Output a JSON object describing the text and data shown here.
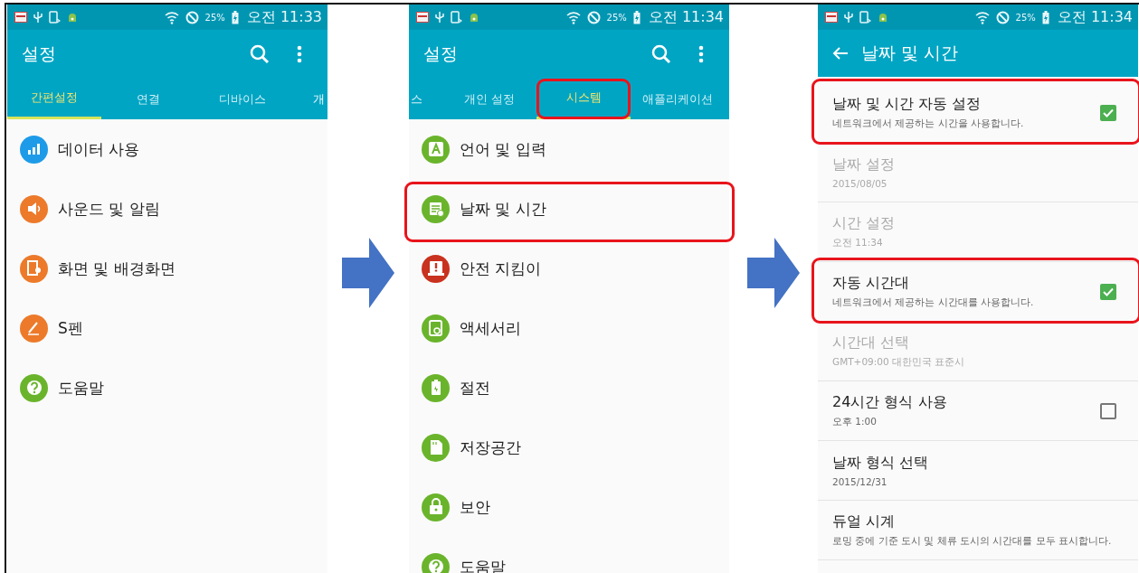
{
  "panels": [
    {
      "status_bar": {
        "battery": "25%",
        "time": "오전 11:33"
      },
      "app_bar": {
        "kind": "main",
        "title": "설정"
      },
      "tabs": [
        {
          "label": "간편설정",
          "kind": "full",
          "selected": true,
          "highlighted": false
        },
        {
          "label": "연결",
          "kind": "full",
          "selected": false,
          "highlighted": false
        },
        {
          "label": "디바이스",
          "kind": "full",
          "selected": false,
          "highlighted": false
        },
        {
          "label": "개",
          "kind": "cut-end",
          "selected": false,
          "highlighted": false
        }
      ],
      "items": [
        {
          "label": "데이터 사용",
          "kind": "chart",
          "color": "#1e9be8",
          "highlighted": false
        },
        {
          "label": "사운드 및 알림",
          "kind": "sound",
          "color": "#ec7a2a",
          "highlighted": false
        },
        {
          "label": "화면 및 배경화면",
          "kind": "screen",
          "color": "#ec7a2a",
          "highlighted": false
        },
        {
          "label": "S펜",
          "kind": "pen",
          "color": "#ec7a2a",
          "highlighted": false
        },
        {
          "label": "도움말",
          "kind": "help",
          "color": "#6ab42c",
          "highlighted": false
        }
      ]
    },
    {
      "status_bar": {
        "battery": "25%",
        "time": "오전 11:34"
      },
      "app_bar": {
        "kind": "main",
        "title": "설정"
      },
      "tabs": [
        {
          "label": "스",
          "kind": "cut-start",
          "selected": false,
          "highlighted": false
        },
        {
          "label": "개인 설정",
          "kind": "full",
          "selected": false,
          "highlighted": false
        },
        {
          "label": "시스템",
          "kind": "full",
          "selected": true,
          "highlighted": true
        },
        {
          "label": "애플리케이션",
          "kind": "full",
          "selected": false,
          "highlighted": false
        }
      ],
      "items": [
        {
          "label": "언어 및 입력",
          "kind": "letter",
          "color": "#6ab42c",
          "highlighted": false
        },
        {
          "label": "날짜 및 시간",
          "kind": "calendar",
          "color": "#6ab42c",
          "highlighted": true
        },
        {
          "label": "안전 지킴이",
          "kind": "alert",
          "color": "#c8321e",
          "highlighted": false
        },
        {
          "label": "액세서리",
          "kind": "accessory",
          "color": "#6ab42c",
          "highlighted": false
        },
        {
          "label": "절전",
          "kind": "battery",
          "color": "#6ab42c",
          "highlighted": false
        },
        {
          "label": "저장공간",
          "kind": "storage",
          "color": "#6ab42c",
          "highlighted": false
        },
        {
          "label": "보안",
          "kind": "lock",
          "color": "#6ab42c",
          "highlighted": false
        },
        {
          "label": "도움말",
          "kind": "help",
          "color": "#6ab42c",
          "highlighted": false
        }
      ]
    },
    {
      "status_bar": {
        "battery": "25%",
        "time": "오전 11:34"
      },
      "app_bar": {
        "kind": "sub",
        "title": "날짜 및 시간"
      },
      "settings": [
        {
          "title": "날짜 및 시간 자동 설정",
          "subtitle": "네트워크에서 제공하는 시간을 사용합니다.",
          "disabled": false,
          "kind": "checkbox",
          "checked": true,
          "highlighted": true
        },
        {
          "title": "날짜 설정",
          "subtitle": "2015/08/05",
          "disabled": true,
          "kind": "plain",
          "highlighted": false
        },
        {
          "title": "시간 설정",
          "subtitle": "오전 11:34",
          "disabled": true,
          "kind": "plain",
          "highlighted": false
        },
        {
          "title": "자동 시간대",
          "subtitle": "네트워크에서 제공하는 시간대를 사용합니다.",
          "disabled": false,
          "kind": "checkbox",
          "checked": true,
          "highlighted": true
        },
        {
          "title": "시간대 선택",
          "subtitle": "GMT+09:00 대한민국 표준시",
          "disabled": true,
          "kind": "plain",
          "highlighted": false
        },
        {
          "title": "24시간 형식 사용",
          "subtitle": "오후 1:00",
          "disabled": false,
          "kind": "checkbox",
          "checked": false,
          "highlighted": false
        },
        {
          "title": "날짜 형식 선택",
          "subtitle": "2015/12/31",
          "disabled": false,
          "kind": "plain",
          "highlighted": false
        },
        {
          "title": "듀얼 시계",
          "subtitle": "로밍 중에 기준 도시 및 체류 도시의 시간대를 모두 표시합니다.",
          "disabled": false,
          "kind": "plain",
          "highlighted": false
        }
      ]
    }
  ]
}
